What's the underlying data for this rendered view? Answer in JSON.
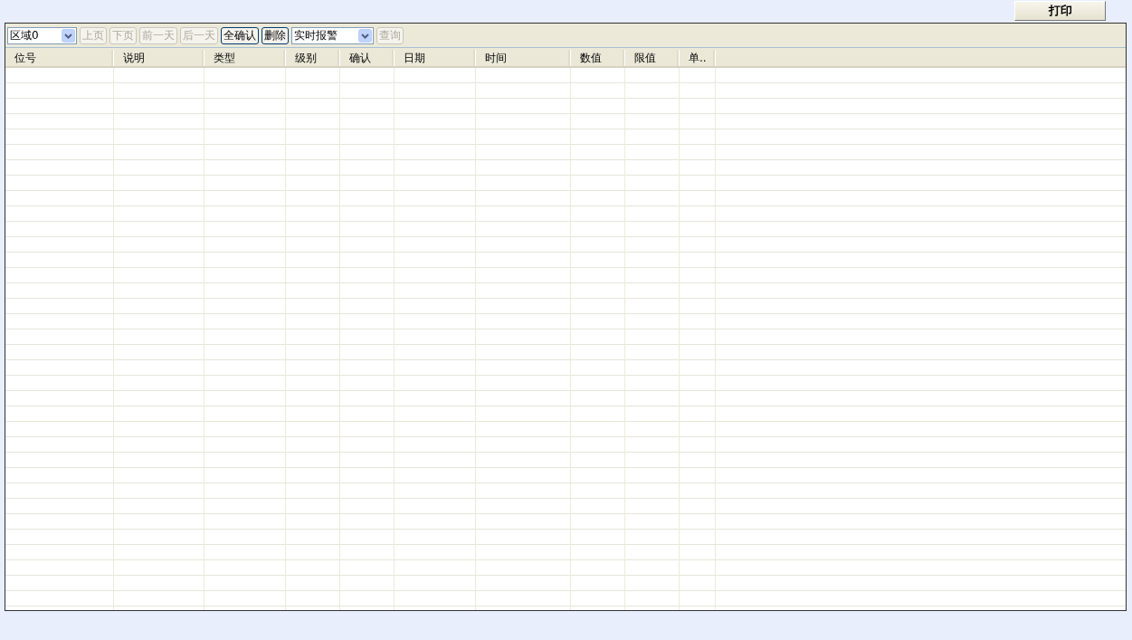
{
  "print_button": {
    "label": "打印"
  },
  "toolbar": [
    {
      "kind": "select",
      "value": "区域0"
    },
    {
      "kind": "button",
      "label": "上页",
      "disabled": true
    },
    {
      "kind": "button",
      "label": "下页",
      "disabled": true
    },
    {
      "kind": "button",
      "label": "前一天",
      "disabled": true
    },
    {
      "kind": "button",
      "label": "后一天",
      "disabled": true
    },
    {
      "kind": "button",
      "label": "全确认",
      "disabled": false
    },
    {
      "kind": "button",
      "label": "删除",
      "disabled": false
    },
    {
      "kind": "select",
      "value": "实时报警"
    },
    {
      "kind": "button",
      "label": "查询",
      "disabled": true
    }
  ],
  "table": {
    "columns": [
      "位号",
      "说明",
      "类型",
      "级别",
      "确认",
      "日期",
      "时间",
      "数值",
      "限值",
      "单.."
    ]
  }
}
